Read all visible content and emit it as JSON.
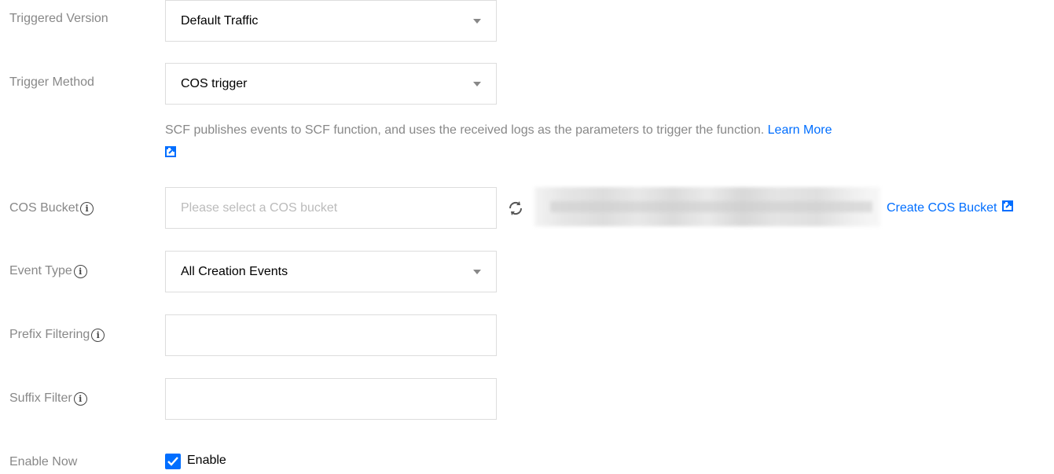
{
  "form": {
    "triggered_version": {
      "label": "Triggered Version",
      "value": "Default Traffic"
    },
    "trigger_method": {
      "label": "Trigger Method",
      "value": "COS trigger",
      "description": "SCF publishes events to SCF function, and uses the received logs as the parameters to trigger the function.",
      "learn_more": "Learn More"
    },
    "cos_bucket": {
      "label": "COS Bucket",
      "placeholder": "Please select a COS bucket",
      "create_link": "Create COS Bucket"
    },
    "event_type": {
      "label": "Event Type",
      "value": "All Creation Events"
    },
    "prefix_filtering": {
      "label": "Prefix Filtering",
      "value": ""
    },
    "suffix_filter": {
      "label": "Suffix Filter",
      "value": ""
    },
    "enable_now": {
      "label": "Enable Now",
      "checkbox_label": "Enable",
      "checked": true
    }
  },
  "icons": {
    "info": "info-circle-icon",
    "external": "external-link-icon",
    "refresh": "refresh-icon",
    "dropdown": "caret-down-icon",
    "check": "checkmark-icon"
  },
  "colors": {
    "link": "#006eff",
    "label": "#888888",
    "border": "#dddddd",
    "placeholder": "#bbbbbb"
  }
}
